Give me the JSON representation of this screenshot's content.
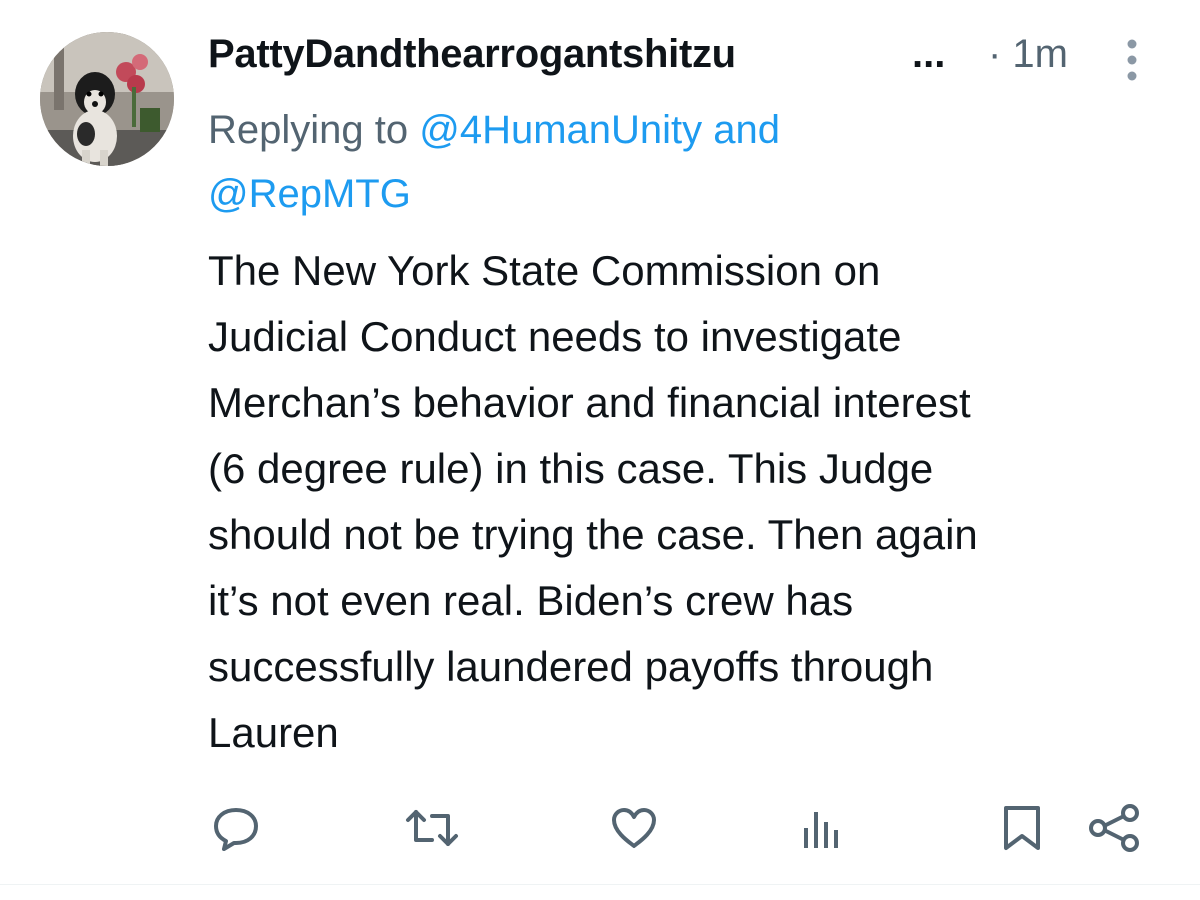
{
  "tweet": {
    "display_name": "PattyDandthearrogantshitzu",
    "name_ellipsis": "...",
    "time": "· 1m",
    "replying_prefix": "Replying to ",
    "mention_1": "@4HumanUnity",
    "replying_joiner": " and",
    "mention_2": "@RepMTG",
    "body": "The New York State Commission on\nJudicial Conduct needs to investigate\nMerchan’s behavior and financial interest\n(6 degree rule) in this case. This Judge\nshould not be trying the case. Then again\nit’s not even real. Biden’s crew has\nsuccessfully laundered payoffs through\nLauren"
  },
  "icons": {
    "avatar": "dog-photo-avatar",
    "more": "more-vertical-icon",
    "reply": "reply-icon",
    "retweet": "retweet-icon",
    "like": "heart-icon",
    "views": "views-icon",
    "bookmark": "bookmark-icon",
    "share": "share-icon"
  },
  "colors": {
    "text": "#0f1419",
    "secondary": "#536471",
    "link": "#1d9bf0"
  }
}
